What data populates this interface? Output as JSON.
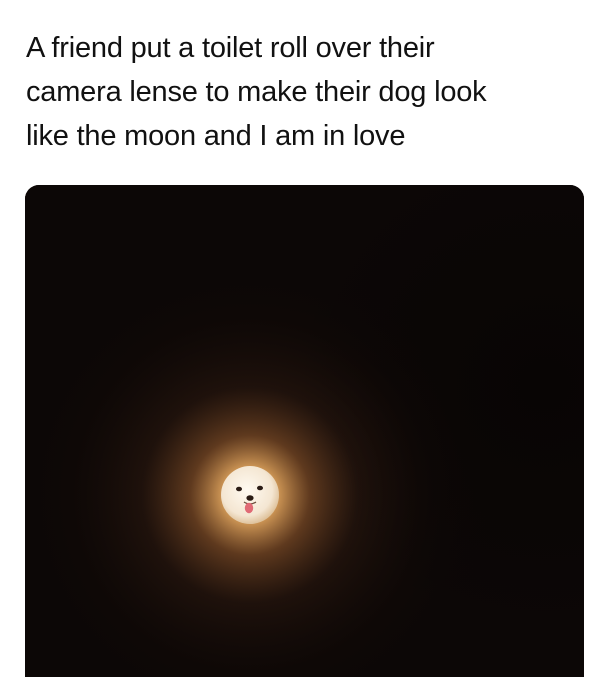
{
  "post": {
    "caption_lines": [
      "A friend put a toilet roll over their",
      "camera lense to make their dog look",
      "like the moon and I am in love"
    ]
  },
  "photo": {
    "subject": "dog-face-moon",
    "colors": {
      "background": "#0c0706",
      "glow": "#d69a55",
      "moon": "#f6ead8",
      "tongue": "#e06a75"
    }
  }
}
